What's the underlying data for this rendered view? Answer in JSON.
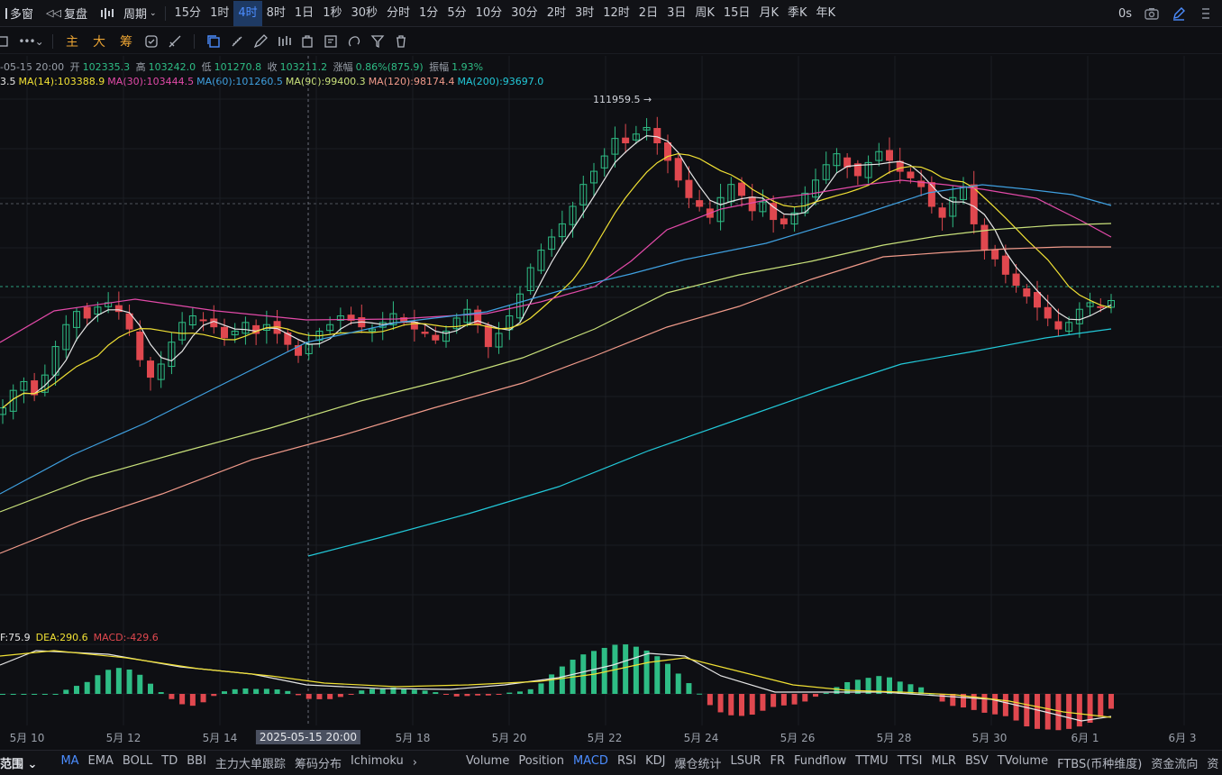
{
  "topbar": {
    "items": [
      {
        "label": "多窗",
        "icon": "grid-icon"
      },
      {
        "label": "复盘",
        "icon": "rewind-icon"
      },
      {
        "label": "",
        "icon": "candle-type-icon"
      },
      {
        "label": "周期",
        "icon": "chevron-down-icon"
      }
    ],
    "timeframes": [
      "15分",
      "1时",
      "4时",
      "8时",
      "1日",
      "1秒",
      "30秒",
      "分时",
      "1分",
      "5分",
      "10分",
      "30分",
      "2时",
      "3时",
      "12时",
      "2日",
      "3日",
      "周K",
      "15日",
      "月K",
      "季K",
      "年K"
    ],
    "active_timeframe": "4时",
    "countdown": "0s"
  },
  "toolbar2": {
    "cn_tools": [
      "主",
      "大",
      "筹"
    ],
    "tool_icons": [
      "square-icon",
      "more-icon",
      "settings-check-icon",
      "drawing-tools-icon",
      "copy-icon",
      "ruler-icon",
      "pen-icon",
      "compare-icon",
      "calendar-lock-icon",
      "note-icon",
      "magnet-icon",
      "filter-icon",
      "trash-icon"
    ]
  },
  "ohlc_info": {
    "date": "-05-15 20:00",
    "open_label": "开",
    "open": "102335.3",
    "high_label": "高",
    "high": "103242.0",
    "low_label": "低",
    "low": "101270.8",
    "close_label": "收",
    "close": "103211.2",
    "change_label": "涨幅",
    "change": "0.86%(875.9)",
    "amp_label": "振幅",
    "amp": "1.93%"
  },
  "ma_info": [
    {
      "label": "3.5",
      "color": "#e6e6e6"
    },
    {
      "label": "MA(14):103388.9",
      "color": "#f0e034"
    },
    {
      "label": "MA(30):103444.5",
      "color": "#e24aa8"
    },
    {
      "label": "MA(60):101260.5",
      "color": "#3fa0e0"
    },
    {
      "label": "MA(90):99400.3",
      "color": "#c8e07a"
    },
    {
      "label": "MA(120):98174.4",
      "color": "#f09a8a"
    },
    {
      "label": "MA(200):93697.0",
      "color": "#22c8d8"
    }
  ],
  "macd_info": [
    {
      "label": "F:75.9",
      "color": "#e6e6e6"
    },
    {
      "label": "DEA:290.6",
      "color": "#f0e034"
    },
    {
      "label": "MACD:-429.6",
      "color": "#e0484f"
    }
  ],
  "high_marker": "111959.5",
  "x_labels": [
    "5月 10",
    "5月 12",
    "5月 14",
    "2025-05-15 20:00",
    "5月 18",
    "5月 20",
    "5月 22",
    "5月 24",
    "5月 26",
    "5月 28",
    "5月 30",
    "6月 1",
    "6月 3"
  ],
  "bottombar": {
    "left_label": "范围",
    "overlays": [
      "MA",
      "EMA",
      "BOLL",
      "TD",
      "BBI",
      "主力大单跟踪",
      "筹码分布",
      "Ichimoku"
    ],
    "subs": [
      "Volume",
      "Position",
      "MACD",
      "RSI",
      "KDJ",
      "爆仓统计",
      "LSUR",
      "FR",
      "Fundflow",
      "TTMU",
      "TTSI",
      "MLR",
      "BSV",
      "TVolume",
      "FTBS(币种维度)",
      "资金流向",
      "资"
    ],
    "active": [
      "MA",
      "MACD"
    ]
  },
  "colors": {
    "up": "#2ebd85",
    "down": "#e0484f",
    "accent": "#4c8dff"
  },
  "chart_data": {
    "type": "candlestick",
    "price_axis_range": [
      88000,
      114000
    ],
    "close_path": [
      99000,
      99800,
      100200,
      99600,
      100500,
      101800,
      102800,
      103400,
      103100,
      103600,
      103800,
      103400,
      102600,
      101200,
      100400,
      101000,
      102000,
      102900,
      103200,
      103000,
      102700,
      102200,
      102500,
      102900,
      102400,
      102800,
      102400,
      101900,
      101400,
      101900,
      102500,
      102800,
      103200,
      103000,
      102700,
      102600,
      102900,
      103300,
      102900,
      102600,
      102400,
      102100,
      102500,
      103100,
      103500,
      102800,
      101800,
      102400,
      103200,
      104200,
      105400,
      106200,
      106800,
      107400,
      108200,
      109200,
      109800,
      110500,
      111300,
      111100,
      111500,
      111800,
      111100,
      110300,
      109400,
      108600,
      108200,
      107700,
      108600,
      109200,
      108700,
      108000,
      108400,
      107600,
      107400,
      107900,
      108800,
      109400,
      110100,
      110600,
      110000,
      109600,
      110200,
      110700,
      110300,
      109800,
      109500,
      109100,
      108200,
      107700,
      108600,
      109100,
      107400,
      106200,
      105800,
      105100,
      104600,
      104100,
      103600,
      103100,
      102600,
      102900,
      103500,
      103800,
      103600,
      103900
    ],
    "ma_series": [
      "MA(14)",
      "MA(30)",
      "MA(60)",
      "MA(90)",
      "MA(120)",
      "MA(200)"
    ],
    "macd": {
      "DIF": 75.9,
      "DEA": 290.6,
      "MACD": -429.6
    }
  }
}
